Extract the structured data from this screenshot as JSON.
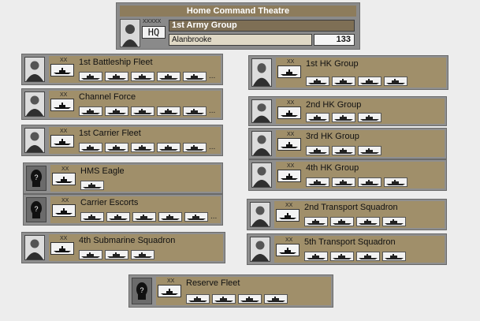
{
  "hq": {
    "title": "Home Command Theatre",
    "designation": "XXXXX",
    "badge": "HQ",
    "name": "1st Army Group",
    "commander": "Alanbrooke",
    "value": "133"
  },
  "units": [
    {
      "id": "u1",
      "name": "1st Battleship Fleet",
      "size": "XX",
      "ships": 5,
      "more": "...",
      "portrait": "person"
    },
    {
      "id": "u2",
      "name": "Channel Force",
      "size": "XX",
      "ships": 5,
      "more": "...",
      "portrait": "person"
    },
    {
      "id": "u3",
      "name": "1st Carrier Fleet",
      "size": "XX",
      "ships": 5,
      "more": "...",
      "portrait": "person"
    },
    {
      "id": "u4",
      "name": "HMS Eagle",
      "size": "XX",
      "ships": 1,
      "more": "",
      "portrait": "unknown"
    },
    {
      "id": "u5",
      "name": "Carrier Escorts",
      "size": "XX",
      "ships": 5,
      "more": "...",
      "portrait": "unknown"
    },
    {
      "id": "u6",
      "name": "4th Submarine Squadron",
      "size": "XX",
      "ships": 3,
      "more": "",
      "portrait": "person"
    },
    {
      "id": "u7",
      "name": "1st HK Group",
      "size": "XX",
      "ships": 4,
      "more": "",
      "portrait": "person"
    },
    {
      "id": "u8",
      "name": "2nd HK Group",
      "size": "XX",
      "ships": 3,
      "more": "",
      "portrait": "person"
    },
    {
      "id": "u9",
      "name": "3rd HK Group",
      "size": "XX",
      "ships": 3,
      "more": "",
      "portrait": "person"
    },
    {
      "id": "u10",
      "name": "4th HK Group",
      "size": "XX",
      "ships": 4,
      "more": "",
      "portrait": "person"
    },
    {
      "id": "u11",
      "name": "2nd Transport Squadron",
      "size": "XX",
      "ships": 4,
      "more": "",
      "portrait": "person"
    },
    {
      "id": "u12",
      "name": "5th Transport Squadron",
      "size": "XX",
      "ships": 4,
      "more": "",
      "portrait": "person"
    },
    {
      "id": "u13",
      "name": "Reserve Fleet",
      "size": "XX",
      "ships": 4,
      "more": "",
      "portrait": "unknown"
    }
  ]
}
